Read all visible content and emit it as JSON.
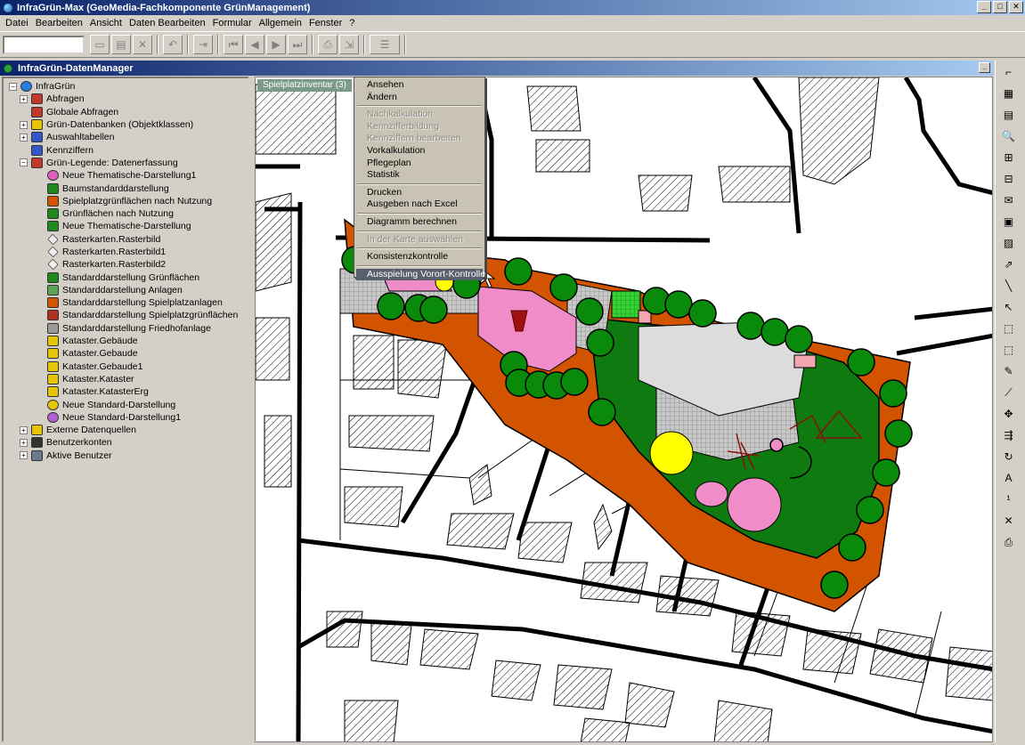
{
  "window": {
    "title": "InfraGrün-Max (GeoMedia-Fachkomponente GrünManagement)",
    "min_label": "_",
    "max_label": "□",
    "close_label": "✕"
  },
  "menubar": {
    "items": [
      "Datei",
      "Bearbeiten",
      "Ansicht",
      "Daten Bearbeiten",
      "Formular",
      "Allgemein",
      "Fenster",
      "?"
    ]
  },
  "panel": {
    "title": "InfraGrün-DatenManager",
    "min_label": "_"
  },
  "tree": {
    "items": [
      {
        "label": "InfraGrün",
        "level": 0,
        "expander": "−",
        "icon": "globe-icon",
        "color": "#2a7de1"
      },
      {
        "label": "Abfragen",
        "level": 1,
        "expander": "+",
        "icon": "query-icon",
        "color": "#c0392b"
      },
      {
        "label": "Globale Abfragen",
        "level": 1,
        "expander": "",
        "icon": "query-icon",
        "color": "#c0392b"
      },
      {
        "label": "Grün-Datenbanken (Objektklassen)",
        "level": 1,
        "expander": "+",
        "icon": "database-icon",
        "color": "#e6c600"
      },
      {
        "label": "Auswahltabellen",
        "level": 1,
        "expander": "+",
        "icon": "table-icon",
        "color": "#3456c8"
      },
      {
        "label": "Kennziffern",
        "level": 1,
        "expander": "",
        "icon": "key-number-icon",
        "color": "#3456c8"
      },
      {
        "label": "Grün-Legende: Datenerfassung",
        "level": 1,
        "expander": "−",
        "icon": "legend-icon",
        "color": "#c0392b"
      },
      {
        "label": "Neue Thematische-Darstellung1",
        "level": 2,
        "expander": "",
        "icon": "thematic-icon",
        "color": "#e060c0"
      },
      {
        "label": "Baumstandarddarstellung",
        "level": 2,
        "expander": "",
        "icon": "tree-icon",
        "color": "#1e8a1e"
      },
      {
        "label": "Spielplatzgrünflächen nach Nutzung",
        "level": 2,
        "expander": "",
        "icon": "area-icon",
        "color": "#d35400"
      },
      {
        "label": "Grünflächen nach Nutzung",
        "level": 2,
        "expander": "",
        "icon": "area-icon",
        "color": "#1e8a1e"
      },
      {
        "label": "Neue Thematische-Darstellung",
        "level": 2,
        "expander": "",
        "icon": "area-icon",
        "color": "#1e8a1e"
      },
      {
        "label": "Rasterkarten.Rasterbild",
        "level": 2,
        "expander": "",
        "icon": "raster-icon",
        "color": "#c8c8c8"
      },
      {
        "label": "Rasterkarten.Rasterbild1",
        "level": 2,
        "expander": "",
        "icon": "raster-icon",
        "color": "#c8c8c8"
      },
      {
        "label": "Rasterkarten.Rasterbild2",
        "level": 2,
        "expander": "",
        "icon": "raster-icon",
        "color": "#c8c8c8"
      },
      {
        "label": "Standarddarstellung Grünflächen",
        "level": 2,
        "expander": "",
        "icon": "area-icon",
        "color": "#1e8a1e"
      },
      {
        "label": "Standarddarstellung Anlagen",
        "level": 2,
        "expander": "",
        "icon": "area-icon",
        "color": "#5aa55a"
      },
      {
        "label": "Standarddarstellung Spielplatzanlagen",
        "level": 2,
        "expander": "",
        "icon": "area-icon",
        "color": "#d35400"
      },
      {
        "label": "Standarddarstellung Spielplatzgrünflächen",
        "level": 2,
        "expander": "",
        "icon": "area-icon",
        "color": "#b03020"
      },
      {
        "label": "Standarddarstellung Friedhofanlage",
        "level": 2,
        "expander": "",
        "icon": "area-icon",
        "color": "#9a9a9a"
      },
      {
        "label": "Kataster.Gebäude",
        "level": 2,
        "expander": "",
        "icon": "cadastre-icon",
        "color": "#e6c600"
      },
      {
        "label": "Kataster.Gebaude",
        "level": 2,
        "expander": "",
        "icon": "cadastre-icon",
        "color": "#e6c600"
      },
      {
        "label": "Kataster.Gebaude1",
        "level": 2,
        "expander": "",
        "icon": "cadastre-icon",
        "color": "#e6c600"
      },
      {
        "label": "Kataster.Kataster",
        "level": 2,
        "expander": "",
        "icon": "cadastre-icon",
        "color": "#e6c600"
      },
      {
        "label": "Kataster.KatasterErg",
        "level": 2,
        "expander": "",
        "icon": "cadastre-icon",
        "color": "#e6c600"
      },
      {
        "label": "Neue Standard-Darstellung",
        "level": 2,
        "expander": "",
        "icon": "standard-icon",
        "color": "#e6c600"
      },
      {
        "label": "Neue Standard-Darstellung1",
        "level": 2,
        "expander": "",
        "icon": "standard-icon",
        "color": "#b060d0"
      },
      {
        "label": "Externe Datenquellen",
        "level": 1,
        "expander": "+",
        "icon": "datasource-icon",
        "color": "#e6c600"
      },
      {
        "label": "Benutzerkonten",
        "level": 1,
        "expander": "+",
        "icon": "user-accounts-icon",
        "color": "#333333"
      },
      {
        "label": "Aktive Benutzer",
        "level": 1,
        "expander": "+",
        "icon": "active-users-icon",
        "color": "#6a7a8a"
      }
    ]
  },
  "map": {
    "tab_label": "Spielplatzinventar (3)"
  },
  "context_menu": {
    "items": [
      {
        "label": "Ansehen",
        "state": "enabled"
      },
      {
        "label": "Ändern",
        "state": "enabled"
      },
      {
        "label": "",
        "state": "separator"
      },
      {
        "label": "Nachkalkulation",
        "state": "disabled"
      },
      {
        "label": "Kennzifferbildung",
        "state": "disabled"
      },
      {
        "label": "Kennziffern bearbeiten",
        "state": "disabled"
      },
      {
        "label": "Vorkalkulation",
        "state": "enabled"
      },
      {
        "label": "Pflegeplan",
        "state": "enabled"
      },
      {
        "label": "Statistik",
        "state": "enabled"
      },
      {
        "label": "",
        "state": "separator"
      },
      {
        "label": "Drucken",
        "state": "enabled"
      },
      {
        "label": "Ausgeben nach Excel",
        "state": "enabled"
      },
      {
        "label": "",
        "state": "separator"
      },
      {
        "label": "Diagramm berechnen",
        "state": "enabled"
      },
      {
        "label": "",
        "state": "separator"
      },
      {
        "label": "In der Karte auswählen",
        "state": "disabled"
      },
      {
        "label": "",
        "state": "separator"
      },
      {
        "label": "Konsistenzkontrolle",
        "state": "enabled"
      },
      {
        "label": "",
        "state": "separator"
      },
      {
        "label": "Ausspielung Vorort-Kontrolle",
        "state": "selected"
      }
    ]
  },
  "right_toolbar": {
    "tools": [
      {
        "icon": "line-tool-icon",
        "glyph": "⌐"
      },
      {
        "icon": "layers-icon",
        "glyph": "▦"
      },
      {
        "icon": "folder-icon",
        "glyph": "▤"
      },
      {
        "icon": "zoom-icon",
        "glyph": "🔍"
      },
      {
        "icon": "zoom-in-icon",
        "glyph": "⊞"
      },
      {
        "icon": "zoom-out-icon",
        "glyph": "⊟"
      },
      {
        "icon": "mail-icon",
        "glyph": "✉"
      },
      {
        "icon": "grid-icon",
        "glyph": "▣"
      },
      {
        "icon": "raster-tool-icon",
        "glyph": "▨"
      },
      {
        "icon": "path-icon",
        "glyph": "⇗"
      },
      {
        "icon": "measure-icon",
        "glyph": "╲"
      },
      {
        "icon": "select-arrow-icon",
        "glyph": "↖"
      },
      {
        "icon": "select-area-icon",
        "glyph": "⬚"
      },
      {
        "icon": "select-fence-icon",
        "glyph": "⬚"
      },
      {
        "icon": "edit-icon",
        "glyph": "✎"
      },
      {
        "icon": "vertex-icon",
        "glyph": "⟋"
      },
      {
        "icon": "move-icon",
        "glyph": "✥"
      },
      {
        "icon": "split-icon",
        "glyph": "⇶"
      },
      {
        "icon": "rotate-icon",
        "glyph": "↻"
      },
      {
        "icon": "text-icon",
        "glyph": "A"
      },
      {
        "icon": "label-icon",
        "glyph": "¹"
      },
      {
        "icon": "delete-icon",
        "glyph": "✕"
      },
      {
        "icon": "print-icon",
        "glyph": "⎙"
      }
    ]
  }
}
